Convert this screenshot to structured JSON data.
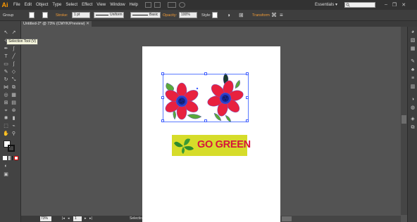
{
  "app": {
    "logo": "Ai"
  },
  "menubar": {
    "items": [
      "File",
      "Edit",
      "Object",
      "Type",
      "Select",
      "Effect",
      "View",
      "Window",
      "Help"
    ],
    "workspace": "Essentials",
    "workspace_chevron": "▾",
    "search_icon": "magnifier-icon",
    "window_controls": [
      "–",
      "❐",
      "✕"
    ]
  },
  "controlbar": {
    "selection_type": "Group",
    "stroke_label": "Stroke:",
    "stroke_weight": "1 pt",
    "uniform_label": "Uniform",
    "basic_label": "Basic",
    "opacity_label": "Opacity:",
    "opacity_value": "100%",
    "style_label": "Style:",
    "transform_label": "Transform"
  },
  "document": {
    "tab_title": "Untitled-2* @ 73% (CMYK/Preview)",
    "tab_close": "✕"
  },
  "tooltip": {
    "text": "Selection Tool (V)"
  },
  "statusbar": {
    "zoom": "73%",
    "artboard_number": "1",
    "current_tool": "Selection"
  },
  "artwork": {
    "banner_text": "GO GREEN",
    "colors": {
      "petal": "#e8213f",
      "petal_outline": "#6a5acd",
      "center": "#1e3cc8",
      "leaf": "#5aa83a",
      "dark_leaf": "#1b3a2a",
      "banner_bg": "#d6dc2a",
      "banner_text": "#d6143c",
      "selection": "#3d5cff"
    }
  }
}
